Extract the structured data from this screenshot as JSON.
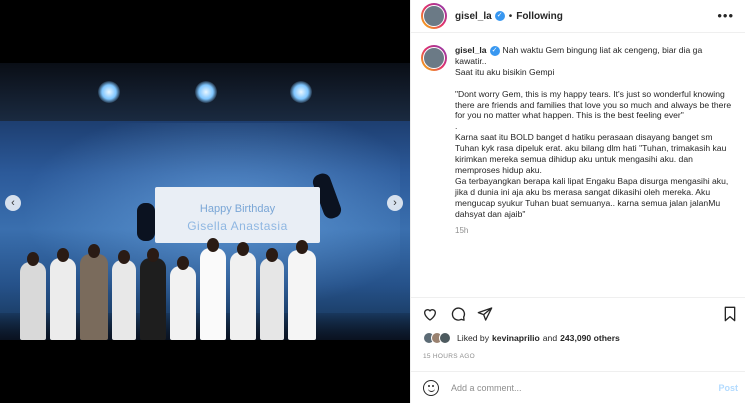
{
  "post": {
    "username": "gisel_la",
    "separator": "•",
    "follow_label": "Following",
    "more_label": "•••",
    "caption": {
      "username": "gisel_la",
      "lines": [
        "Nah waktu Gem bingung liat ak cengeng, biar dia ga kawatir..",
        "Saat itu aku bisikin Gempi",
        "",
        "\"Dont worry Gem, this is my happy tears. It's just so wonderful knowing there are friends and families that love you so much and always be there for you no matter what happen. This is the best feeling ever\"",
        ".",
        "Karna saat itu BOLD banget d hatiku perasaan disayang banget sm Tuhan kyk rasa dipeluk erat. aku bilang dlm hati \"Tuhan, trimakasih kau kirimkan mereka semua dihidup aku untuk mengasihi aku. dan memproses hidup aku.",
        "Ga terbayangkan berapa kali lipat Engaku Bapa disurga mengasihi aku, jika d dunia ini aja aku bs merasa sangat dikasihi oleh mereka. Aku mengucap syukur Tuhan buat semuanya.. karna semua jalan jalanMu dahsyat dan ajaib\""
      ],
      "time": "15h"
    },
    "photo": {
      "banner_line1": "Happy Birthday",
      "banner_line2": "Gisella Anastasia"
    },
    "likes": {
      "prefix": "Liked by",
      "user": "kevinaprilio",
      "and": "and",
      "count": "243,090 others"
    },
    "posted": "15 HOURS AGO",
    "comment": {
      "placeholder": "Add a comment...",
      "post_label": "Post"
    },
    "nav": {
      "prev": "‹",
      "next": "›"
    },
    "icons": [
      "heart-icon",
      "comment-icon",
      "share-icon",
      "bookmark-icon",
      "emoji-icon",
      "verified-icon",
      "more-icon"
    ]
  }
}
